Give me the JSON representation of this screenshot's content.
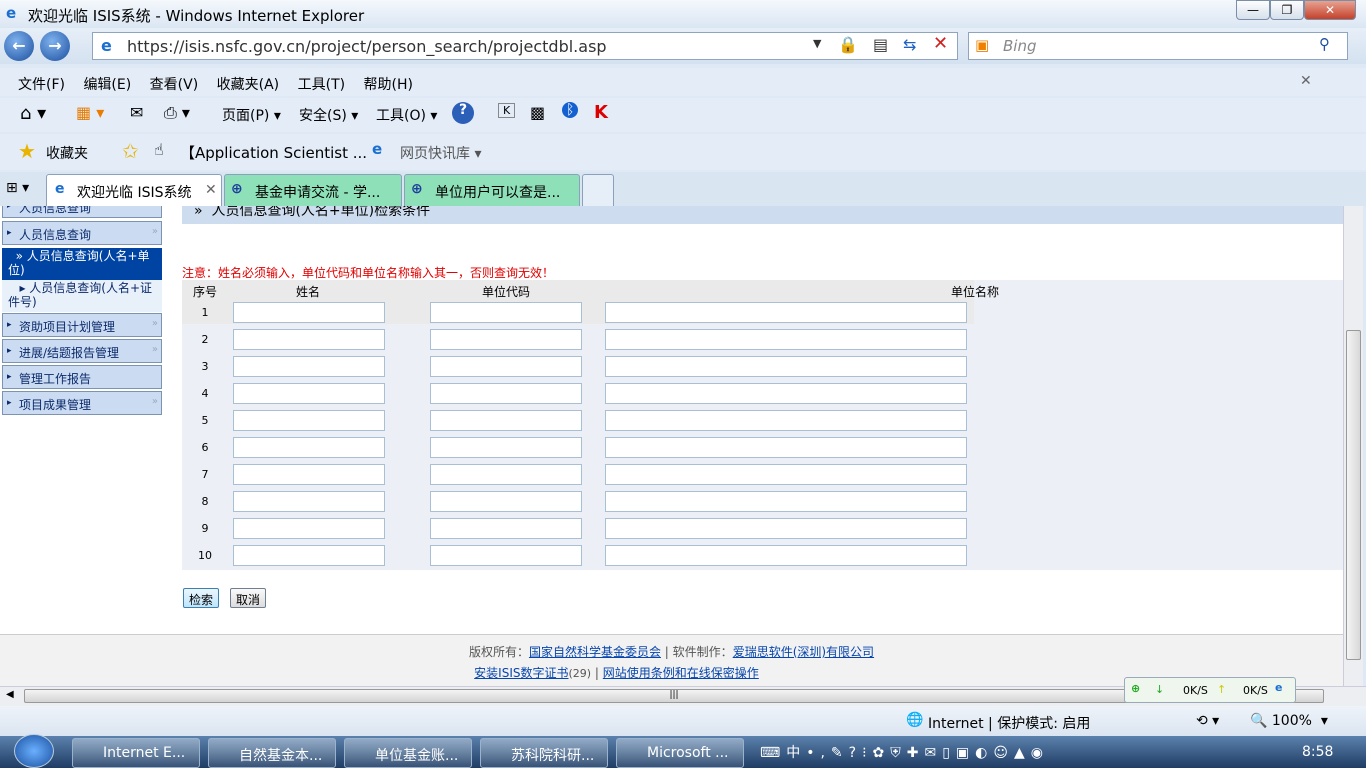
{
  "window": {
    "title": "欢迎光临 ISIS系统 - Windows Internet Explorer"
  },
  "address": {
    "url": "https://isis.nsfc.gov.cn/project/person_search/projectdbl.asp",
    "search_placeholder": "Bing"
  },
  "menu": [
    "文件(F)",
    "编辑(E)",
    "查看(V)",
    "收藏夹(A)",
    "工具(T)",
    "帮助(H)"
  ],
  "command": {
    "page": "页面(P)",
    "safety": "安全(S)",
    "tools": "工具(O)"
  },
  "favorites": {
    "label": "收藏夹",
    "item1": "【Application Scientist ...",
    "item2": "网页快讯库"
  },
  "tabs": [
    "欢迎光临 ISIS系统",
    "基金申请交流 - 学...",
    "单位用户可以查是..."
  ],
  "sidebar": {
    "top_clipped": "人员信息查询",
    "items": [
      "人员信息查询",
      "人员信息查询(人名+单位)",
      "人员信息查询(人名+证件号)",
      "资助项目计划管理",
      "进展/结题报告管理",
      "管理工作报告",
      "项目成果管理"
    ]
  },
  "main": {
    "section_title": "人员信息查询(人名+单位)检索条件",
    "notice": "注意：姓名必须输入，单位代码和单位名称输入其一，否则查询无效！",
    "columns": [
      "序号",
      "姓名",
      "单位代码",
      "单位名称"
    ],
    "rows": [
      "1",
      "2",
      "3",
      "4",
      "5",
      "6",
      "7",
      "8",
      "9",
      "10"
    ],
    "search_button": "检索",
    "cancel_button": "取消"
  },
  "footer": {
    "copyright_label": "版权所有：",
    "copyright_link": "国家自然科学基金委员会",
    "software_label": "软件制作：",
    "software_link": "爱瑞思软件(深圳)有限公司",
    "cert_link": "安装ISIS数字证书",
    "cert_count": "(29)",
    "terms_link": "网站使用条例和在线保密操作",
    "sep": "|"
  },
  "netspeed": {
    "down": "0K/S",
    "up": "0K/S"
  },
  "status": {
    "zone": "Internet | 保护模式: 启用",
    "zoom": "100%"
  },
  "taskbar": {
    "items": [
      "Internet E...",
      "自然基金本...",
      "单位基金账...",
      "苏科院科研...",
      "Microsoft ..."
    ],
    "clock": "8:58"
  }
}
